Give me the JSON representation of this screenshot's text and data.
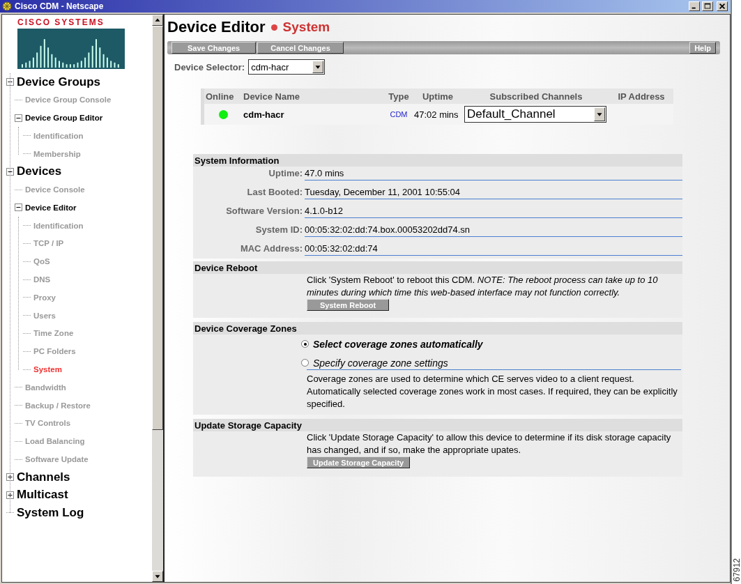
{
  "window": {
    "title": "Cisco CDM - Netscape"
  },
  "logo": {
    "text": "CISCO SYSTEMS"
  },
  "nav": [
    {
      "label": "Device Groups",
      "expanded": true,
      "selected": false,
      "children": [
        {
          "label": "Device Group Console",
          "selected": false
        },
        {
          "label": "Device Group Editor",
          "expanded": true,
          "selected": false,
          "children": [
            {
              "label": "Identification",
              "selected": false
            },
            {
              "label": "Membership",
              "selected": false
            }
          ]
        }
      ]
    },
    {
      "label": "Devices",
      "expanded": true,
      "selected": false,
      "children": [
        {
          "label": "Device Console",
          "selected": false
        },
        {
          "label": "Device Editor",
          "expanded": true,
          "selected": false,
          "children": [
            {
              "label": "Identification",
              "selected": false
            },
            {
              "label": "TCP / IP",
              "selected": false
            },
            {
              "label": "QoS",
              "selected": false
            },
            {
              "label": "DNS",
              "selected": false
            },
            {
              "label": "Proxy",
              "selected": false
            },
            {
              "label": "Users",
              "selected": false
            },
            {
              "label": "Time Zone",
              "selected": false
            },
            {
              "label": "PC Folders",
              "selected": false
            },
            {
              "label": "System",
              "selected": true
            }
          ]
        },
        {
          "label": "Bandwidth",
          "selected": false
        },
        {
          "label": "Backup / Restore",
          "selected": false
        },
        {
          "label": "TV Controls",
          "selected": false
        },
        {
          "label": "Load Balancing",
          "selected": false
        },
        {
          "label": "Software Update",
          "selected": false
        }
      ]
    },
    {
      "label": "Channels",
      "expanded": false,
      "selected": false
    },
    {
      "label": "Multicast",
      "expanded": false,
      "selected": false
    },
    {
      "label": "System Log",
      "selected": false
    }
  ],
  "page": {
    "title": "Device Editor",
    "subtitle": "System"
  },
  "toolbar": {
    "buttons": [
      "Save Changes",
      "Cancel Changes"
    ],
    "help": "Help"
  },
  "device_selector": {
    "label": "Device Selector:",
    "value": "cdm-hacr"
  },
  "device_table": {
    "columns": [
      "Online",
      "Device Name",
      "Type",
      "Uptime",
      "Subscribed Channels",
      "IP Address"
    ],
    "rows": [
      {
        "online": true,
        "name": "cdm-hacr",
        "type": "CDM",
        "uptime": "47:02 mins",
        "channel": "Default_Channel"
      }
    ]
  },
  "system_information": {
    "title": "System Information",
    "fields": [
      {
        "label": "Uptime:",
        "value": "47.0 mins"
      },
      {
        "label": "Last Booted:",
        "value": "Tuesday, December 11, 2001 10:55:04"
      },
      {
        "label": "Software Version:",
        "value": "4.1.0-b12"
      },
      {
        "label": "System ID:",
        "value": "00:05:32:02:dd:74.box.00053202dd74.sn"
      },
      {
        "label": "MAC Address:",
        "value": "00:05:32:02:dd:74"
      }
    ]
  },
  "device_reboot": {
    "title": "Device Reboot",
    "text": "Click 'System Reboot' to reboot this CDM. *NOTE: The reboot process can take up to 10 minutes during which time this web-based interface may not function correctly.*",
    "button": "System Reboot"
  },
  "coverage_zones": {
    "title": "Device Coverage Zones",
    "options": [
      {
        "label": "Select coverage zones automatically",
        "selected": true
      },
      {
        "label": "Specify coverage zone settings",
        "selected": false
      }
    ],
    "text": "Coverage zones are used to determine which CE serves video to a client request. Automatically selected coverage zones work in most cases. If required, they can be explicitly specified."
  },
  "storage": {
    "title": "Update Storage Capacity",
    "text": "Click 'Update Storage Capacity' to allow this device to determine if its disk storage capacity has changed, and if so, make the appropriate upates.",
    "button": "Update Storage Capacity"
  },
  "figure_number": "67912"
}
